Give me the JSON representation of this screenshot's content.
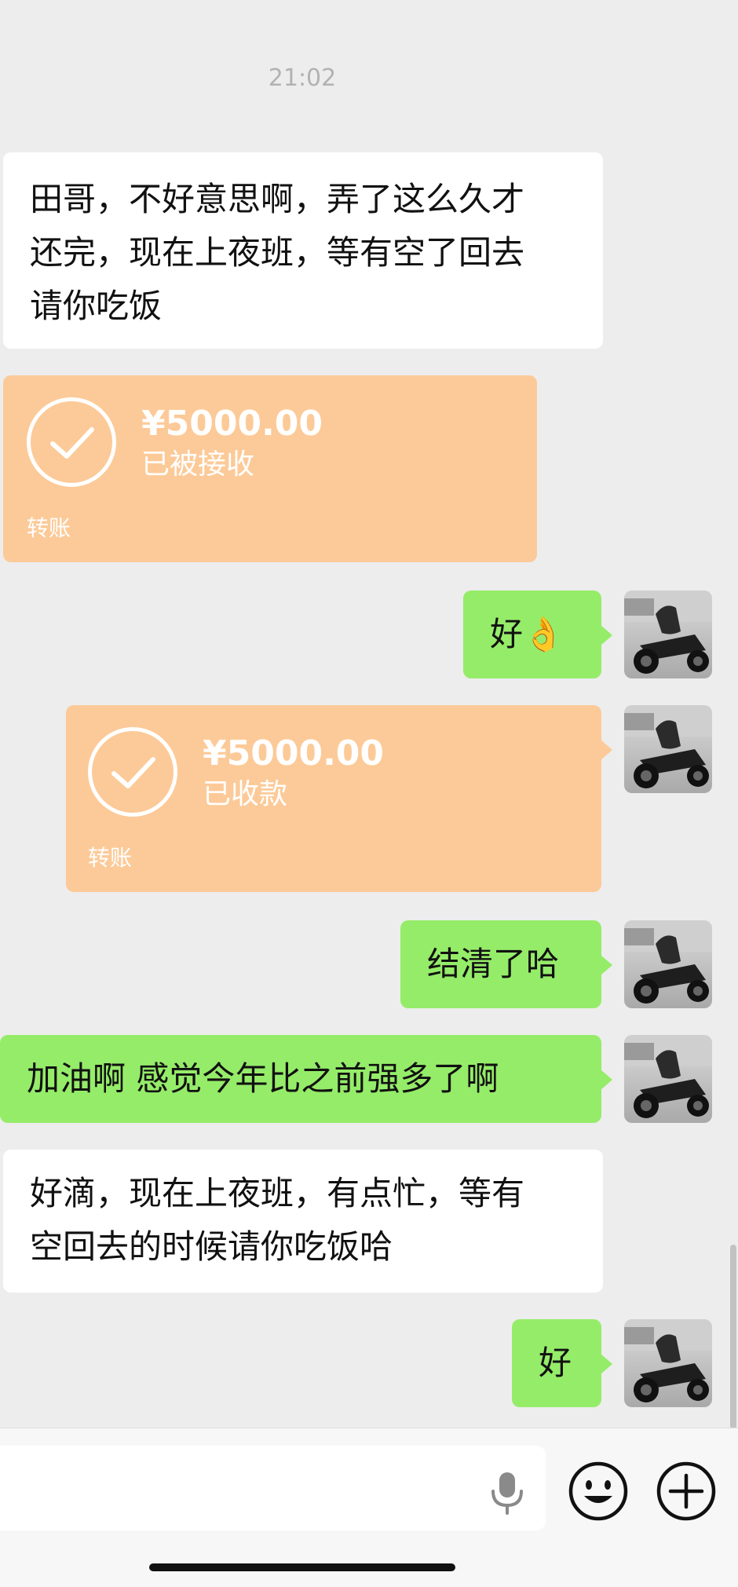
{
  "timestamp": "21:02",
  "messages": [
    {
      "text": "田哥，不好意思啊，弄了这么久才\n还完，现在上夜班，等有空了回去\n请你吃饭"
    },
    {
      "amount": "¥5000.00",
      "status": "已被接收",
      "label": "转账"
    },
    {
      "text": "好👌"
    },
    {
      "amount": "¥5000.00",
      "status": "已收款",
      "label": "转账"
    },
    {
      "text": "结清了哈"
    },
    {
      "text": "加油啊 感觉今年比之前强多了啊"
    },
    {
      "text": "好滴，现在上夜班，有点忙，等有\n空回去的时候请你吃饭哈"
    },
    {
      "text": "好"
    }
  ],
  "icons": {
    "check": "check-circle-icon",
    "mic": "microphone-icon",
    "emoji": "emoji-icon",
    "plus": "plus-icon",
    "avatar": "motorcycle-avatar"
  },
  "colors": {
    "background": "#ededed",
    "green_bubble": "#95ec69",
    "white_bubble": "#ffffff",
    "transfer_bubble": "#fcca98"
  }
}
